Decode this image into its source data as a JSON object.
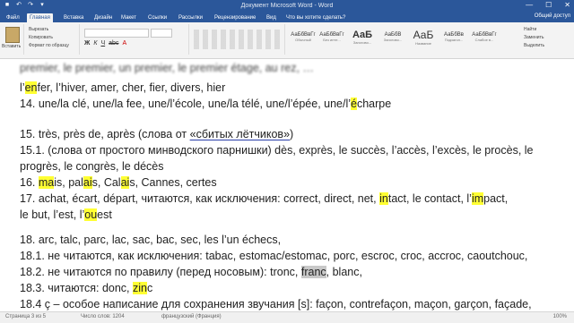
{
  "window": {
    "title": "Документ Microsoft Word - Word",
    "minimize": "—",
    "maximize": "☐",
    "close": "✕"
  },
  "ribbon_tabs": [
    "Файл",
    "Главная",
    "Вставка",
    "Дизайн",
    "Макет",
    "Ссылки",
    "Рассылки",
    "Рецензирование",
    "Вид",
    "Что вы хотите сделать?"
  ],
  "user": "Общий доступ",
  "ribbon": {
    "paste": "Вставить",
    "clipboard": [
      "Вырезать",
      "Копировать",
      "Формат по образцу"
    ],
    "find": [
      "Найти",
      "Заменить",
      "Выделить"
    ],
    "styles": [
      {
        "sample": "АаБбВвГг",
        "name": "Обычный"
      },
      {
        "sample": "АаБбВвГг",
        "name": "Без инте..."
      },
      {
        "sample": "АаБ",
        "name": "Заголово..."
      },
      {
        "sample": "АаБбВ",
        "name": "Заголово..."
      },
      {
        "sample": "АаБ",
        "name": "Название"
      },
      {
        "sample": "АаБбВв",
        "name": "Подзагол..."
      },
      {
        "sample": "АаБбВвГг",
        "name": "Слабое в..."
      }
    ]
  },
  "document": {
    "line0": "premier, le premier, un premier, le premier étage, au rez, …",
    "line1": {
      "p1": "l’",
      "p2": "en",
      "p3": "fer, l’hiver, amer, cher, fier, divers, hier"
    },
    "line2": {
      "p1": "14. une/la clé, une/la fee, une/l’école, une/la télé, une/l’épée, une/l’",
      "p2": "é",
      "p3": "charpe"
    },
    "line3": {
      "p1": "15. très, près de, après (слова от ",
      "p2": "«сбитых лётчиков»",
      "p3": ")"
    },
    "line4": "15.1. (слова от простого минводского парнишки) dès, exprès, le succès, l’accès, l’excès, le procès, le",
    "line5": "progrès, le congrès, le décès",
    "line6": {
      "p1": "16. ",
      "p2": "ma",
      "p3": "is, pal",
      "p4": "ai",
      "p5": "s, Cal",
      "p6": "ai",
      "p7": "s, Cannes, certes"
    },
    "line7": {
      "p1": "17. achat, écart, départ, читаются, как исключения: correct, direct, net, ",
      "p2": "in",
      "p3": "tact, le contact, l’",
      "p4": "im",
      "p5": "pact,"
    },
    "line8": {
      "p1": "le but, l’est, l’",
      "p2": "ou",
      "p3": "est"
    },
    "line9": "18. arc, talc, parc, lac, sac, bac, sec, les l’un échecs,",
    "line10": "18.1. не читаются, как исключения: tabac, estomac/estomac, porc, escroc, croc, accroc, caoutchouc,",
    "line11": {
      "p1": "18.2. не читаются по правилу (перед носовым): tronc, ",
      "p2": "franc",
      "p3": ", blanc,"
    },
    "line12": {
      "p1": "18.3. читаются: donc, ",
      "p2": "zin",
      "p3": "c"
    },
    "line13": "18.4 ç – особое написание для сохранения звучания [s]: façon, contrefaçon, maçon, garçon, façade,"
  },
  "status": {
    "page": "Страница 3 из 5",
    "words": "Число слов: 1204",
    "lang": "французский (Франция)",
    "zoom": "100%"
  }
}
